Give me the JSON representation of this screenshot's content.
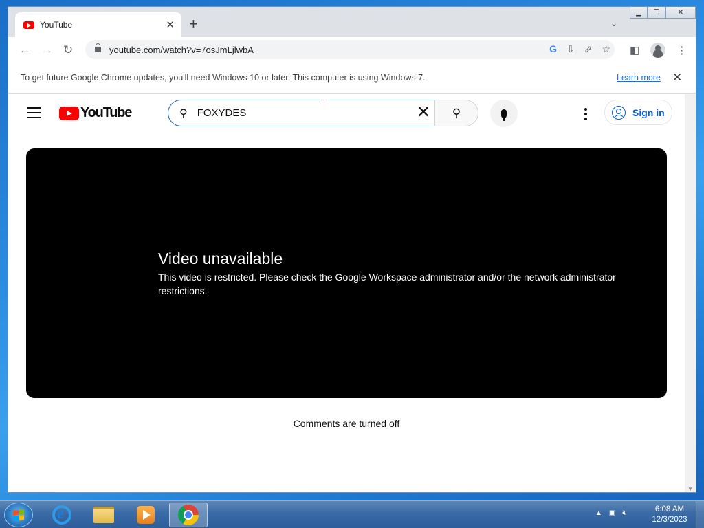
{
  "browser": {
    "tab_title": "YouTube",
    "tab_close": "✕",
    "new_tab": "+",
    "tab_search": "⌄",
    "window_controls": {
      "minimize": "▁",
      "maximize": "❐",
      "close": "✕"
    },
    "nav": {
      "back": "←",
      "forward": "→",
      "reload": "↻"
    },
    "url": "youtube.com/watch?v=7osJmLjlwbA",
    "omnibox_icons": [
      "google-icon",
      "install-icon",
      "share-icon",
      "bookmark-star-icon"
    ],
    "toolbar_icons": [
      "side-panel-icon",
      "profile-icon",
      "menu-icon"
    ]
  },
  "infobar": {
    "message": "To get future Google Chrome updates, you'll need Windows 10 or later. This computer is using Windows 7.",
    "learn_more": "Learn more",
    "close": "✕"
  },
  "youtube": {
    "logo_text": "YouTube",
    "search": {
      "value": "FOXYDES",
      "clear": "✕",
      "search_icon": "⚲"
    },
    "sign_in": "Sign in",
    "player": {
      "title": "Video unavailable",
      "message": "This video is restricted. Please check the Google Workspace administrator and/or the network administrator restrictions."
    },
    "comments_status": "Comments are turned off"
  },
  "taskbar": {
    "apps": [
      "internet-explorer",
      "windows-explorer",
      "windows-media-player",
      "google-chrome"
    ],
    "active_app": "google-chrome",
    "clock_time": "6:08 AM",
    "clock_date": "12/3/2023",
    "tray": {
      "expand": "▲"
    }
  },
  "colors": {
    "youtube_red": "#ff0000",
    "link_blue": "#1a73e8",
    "signin_blue": "#065fd4",
    "player_bg": "#000000"
  }
}
